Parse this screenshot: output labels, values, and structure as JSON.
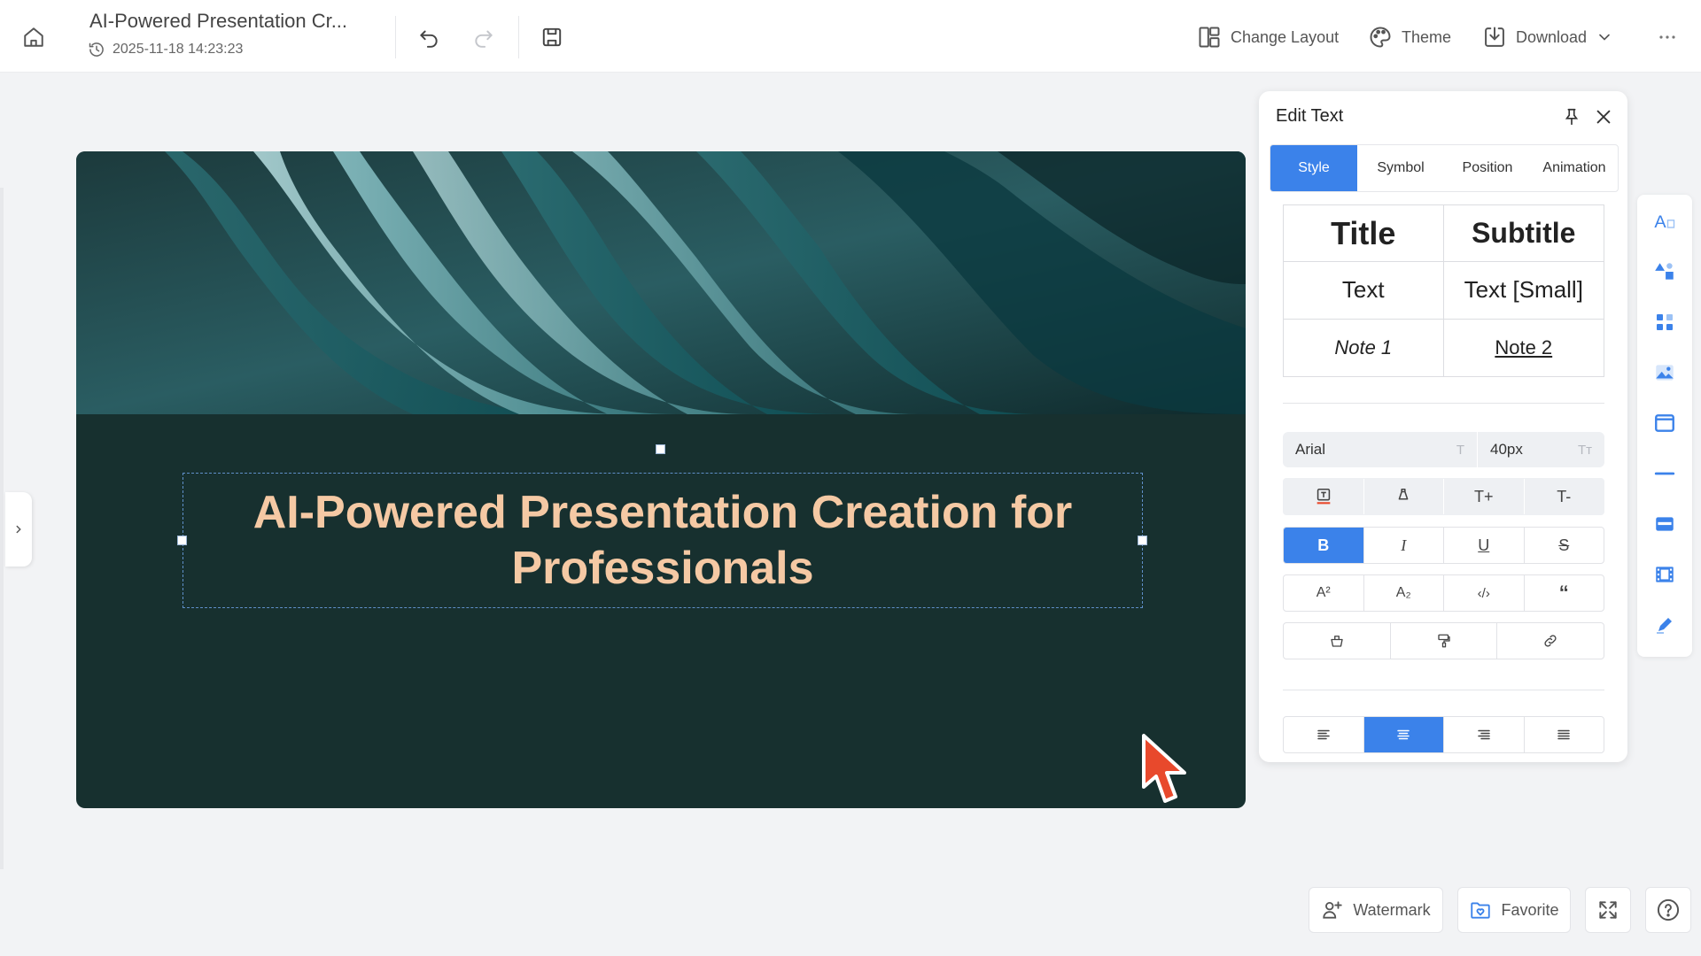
{
  "header": {
    "doc_title": "AI-Powered Presentation Cr...",
    "doc_time": "2025-11-18 14:23:23",
    "change_layout_label": "Change Layout",
    "theme_label": "Theme",
    "download_label": "Download"
  },
  "slide": {
    "title": "AI-Powered Presentation Creation for Professionals",
    "background_color": "#17302f",
    "title_color": "#f5c9a4"
  },
  "edit_panel": {
    "title": "Edit Text",
    "tabs": [
      "Style",
      "Symbol",
      "Position",
      "Animation"
    ],
    "active_tab": "Style",
    "style_presets": [
      "Title",
      "Subtitle",
      "Text",
      "Text [Small]",
      "Note 1",
      "Note 2"
    ],
    "font_name": "Arial",
    "font_size": "40px",
    "size_row": [
      "T+",
      "T-"
    ],
    "format_row": [
      "B",
      "I",
      "U",
      "S"
    ],
    "script_row": [
      "A²",
      "A₂",
      "‹/›",
      "“"
    ],
    "alignment": [
      "left",
      "center",
      "right",
      "justify"
    ],
    "active_alignment": "center",
    "bold_active": true
  },
  "bottom": {
    "watermark_label": "Watermark",
    "favorite_label": "Favorite"
  },
  "right_toolbar": [
    "text-style-icon",
    "shapes-icon",
    "grid-icon",
    "image-icon",
    "frame-icon",
    "divider-icon",
    "table-icon",
    "video-icon",
    "pen-icon"
  ],
  "colors": {
    "accent": "#3b82ea",
    "cursor": "#e8492c"
  }
}
